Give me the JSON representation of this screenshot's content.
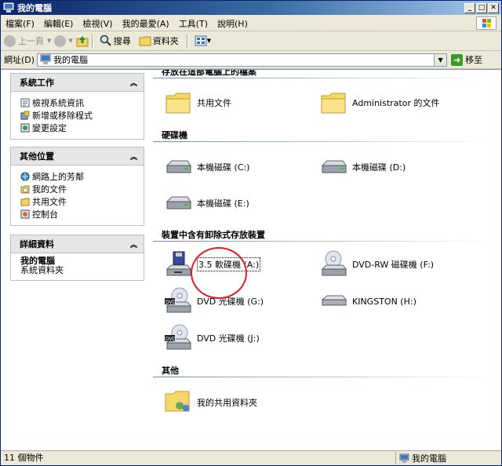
{
  "window": {
    "title": "我的電腦",
    "icon": "my-computer-icon"
  },
  "title_buttons": {
    "minimize": "_",
    "maximize": "□",
    "close": "✕"
  },
  "menu": [
    "檔案(F)",
    "編輯(E)",
    "檢視(V)",
    "我的最愛(A)",
    "工具(T)",
    "說明(H)"
  ],
  "toolbar": {
    "back": "上一頁",
    "search": "搜尋",
    "folders": "資料夾"
  },
  "address": {
    "label": "網址(D)",
    "value": "我的電腦",
    "go": "移至"
  },
  "left_panels": {
    "system": {
      "title": "系統工作",
      "items": [
        "檢視系統資訊",
        "新增或移除程式",
        "變更設定"
      ]
    },
    "other": {
      "title": "其他位置",
      "items": [
        "網路上的芳鄰",
        "我的文件",
        "共用文件",
        "控制台"
      ]
    },
    "details": {
      "title": "詳細資料",
      "name": "我的電腦",
      "desc": "系統資料夾"
    }
  },
  "groups": {
    "files": {
      "title": "存放在這部電腦上的檔案",
      "items": [
        "共用文件",
        "Administrator 的文件"
      ]
    },
    "drives": {
      "title": "硬碟機",
      "items": [
        "本機磁碟 (C:)",
        "本機磁碟 (D:)",
        "本機磁碟 (E:)"
      ]
    },
    "removable": {
      "title": "裝置中含有卸除式存放裝置",
      "items": [
        "3.5 軟碟機 (A:)",
        "DVD-RW 磁碟機 (F:)",
        "DVD 光碟機 (G:)",
        "KINGSTON (H:)",
        "DVD 光碟機 (J:)"
      ]
    },
    "other": {
      "title": "其他",
      "items": [
        "我的共用資料夾"
      ]
    }
  },
  "status": {
    "left": "11 個物件",
    "right": "我的電腦"
  },
  "colors": {
    "title_blue": "#0a246a",
    "annotation_red": "#e02020"
  }
}
